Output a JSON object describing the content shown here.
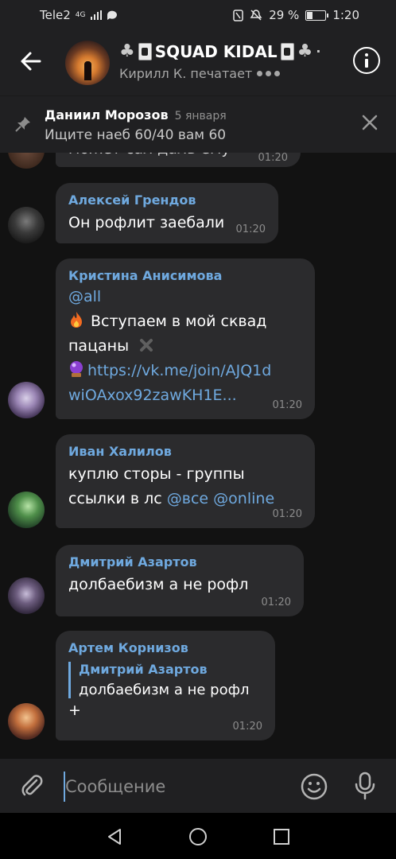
{
  "status_bar": {
    "carrier": "Tele2",
    "network": "4G",
    "battery": "29 %",
    "battery_fraction": 0.29,
    "time": "1:20"
  },
  "header": {
    "title": "SQUAD KIDAL",
    "trailing": "·",
    "subtitle": "Кирилл К. печатает"
  },
  "pinned": {
    "name": "Даниил Морозов",
    "date": "5 января",
    "text": "Ищите наеб 60/40 вам 60"
  },
  "messages": [
    {
      "sender": "",
      "text": "может сал даль ему",
      "time": "01:20"
    },
    {
      "sender": "Алексей Грендов",
      "text": "Он рофлит заебали",
      "time": "01:20"
    },
    {
      "sender": "Кристина Анисимова",
      "mention": "@all",
      "line1": "Вступаем в мой сквад",
      "line2": "пацаны",
      "link1": "https://vk.me/join/AJQ1d",
      "link2": "wiOAxox92zawKH1E...",
      "time": "01:20"
    },
    {
      "sender": "Иван Халилов",
      "line1": "куплю сторы - группы",
      "line2_text": "ссылки в лс",
      "mention1": "@все",
      "mention2": "@online",
      "time": "01:20"
    },
    {
      "sender": "Дмитрий Азартов",
      "text": "долбаебизм а не рофл",
      "time": "01:20"
    },
    {
      "sender": "Артем Корнизов",
      "reply_name": "Дмитрий Азартов",
      "reply_text": "долбаебизм а не рофл",
      "text": "+",
      "time": "01:20"
    }
  ],
  "input": {
    "placeholder": "Сообщение"
  },
  "icons": [
    "back-arrow-icon",
    "info-icon",
    "pin-icon",
    "close-icon",
    "attach-icon",
    "emoji-icon",
    "mic-icon",
    "nav-back-icon",
    "nav-home-icon",
    "nav-recent-icon"
  ],
  "colors": {
    "accent": "#6fa9df",
    "bubble": "#2b2b2d",
    "background": "#121212",
    "bar": "#202022"
  }
}
